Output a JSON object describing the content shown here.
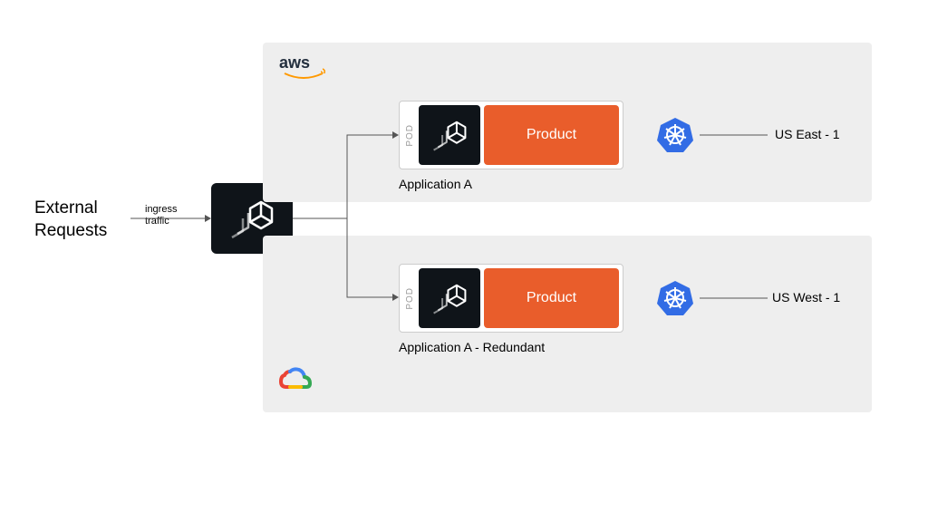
{
  "external": {
    "line1": "External",
    "line2": "Requests"
  },
  "ingress": {
    "line1": "ingress",
    "line2": "traffic"
  },
  "aws": {
    "label": "aws"
  },
  "gcp": {
    "label": "google-cloud"
  },
  "pods": {
    "top": {
      "pod_label": "POD",
      "product_label": "Product",
      "app_label": "Application A",
      "region_label": "US East - 1"
    },
    "bottom": {
      "pod_label": "POD",
      "product_label": "Product",
      "app_label": "Application A - Redundant",
      "region_label": "US West - 1"
    }
  }
}
